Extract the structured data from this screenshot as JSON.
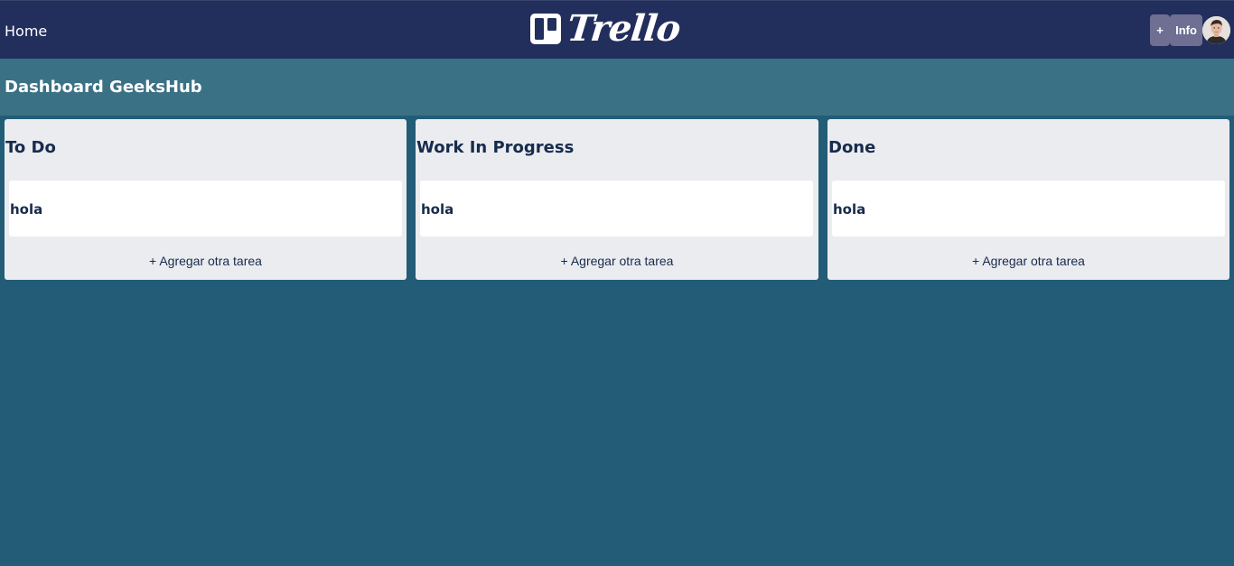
{
  "nav": {
    "home_label": "Home",
    "brand_name": "Trello",
    "add_label": "+",
    "info_label": "Info"
  },
  "board": {
    "title": "Dashboard GeeksHub"
  },
  "lists": [
    {
      "title": "To Do",
      "cards": [
        "hola"
      ],
      "add_label": "+ Agregar otra tarea"
    },
    {
      "title": "Work In Progress",
      "cards": [
        "hola"
      ],
      "add_label": "+ Agregar otra tarea"
    },
    {
      "title": "Done",
      "cards": [
        "hola"
      ],
      "add_label": "+ Agregar otra tarea"
    }
  ],
  "colors": {
    "navbar": "#222e5c",
    "subheader": "#3b7185",
    "background": "#235c77",
    "list_bg": "#ebecf0",
    "card_bg": "#ffffff",
    "text_dark": "#172b4d",
    "button_bg": "#6e6f93"
  },
  "icons": {
    "logo": "trello-logo-icon",
    "avatar": "user-avatar"
  }
}
